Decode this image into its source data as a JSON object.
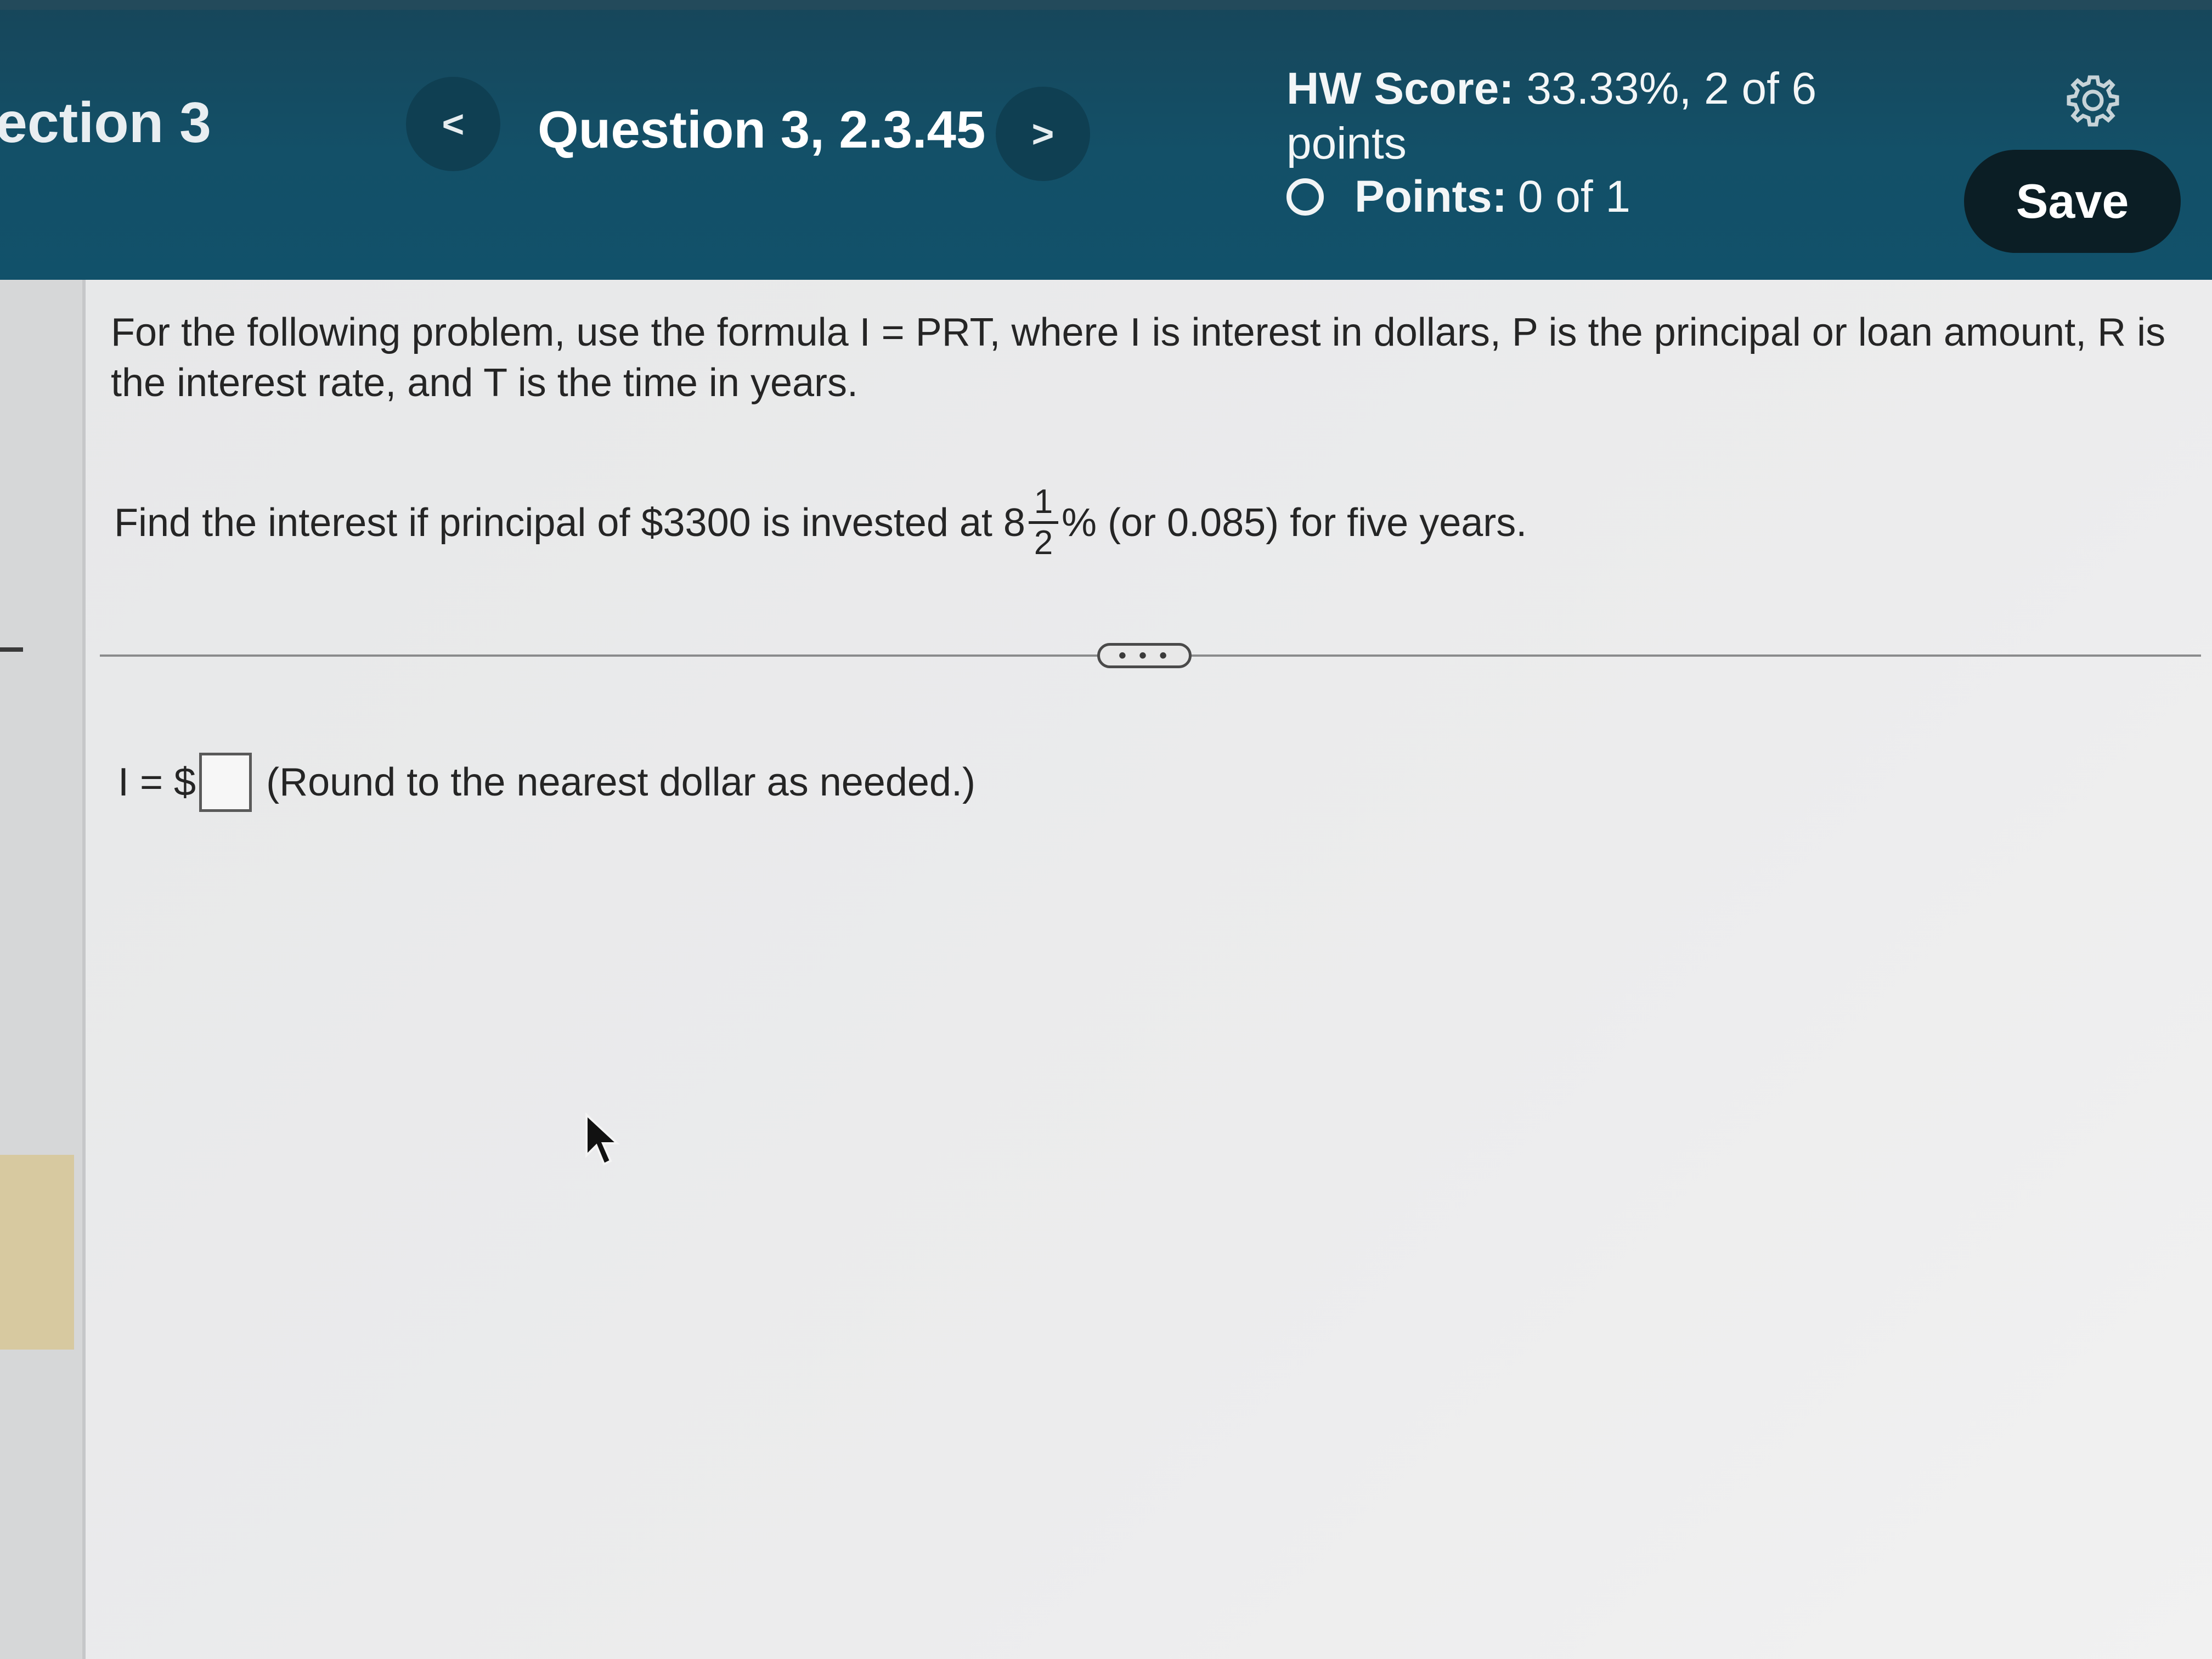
{
  "header": {
    "section_label": "ection 3",
    "question_title": "Question 3, 2.3.45",
    "prev_label": "<",
    "next_label": ">",
    "hw_score_label": "HW Score:",
    "hw_score_value": "33.33%, 2 of 6 points",
    "points_label": "Points:",
    "points_value": "0 of 1",
    "save_label": "Save",
    "colors": {
      "header_bg": "#135068",
      "save_bg": "#0b1e25"
    }
  },
  "problem": {
    "intro": "For the following problem, use the formula I = PRT, where I is interest in dollars, P is the principal or loan amount, R is the interest rate, and T is the time in years.",
    "question_before": "Find the interest if principal of $3300 is invested at 8",
    "fraction_numerator": "1",
    "fraction_denominator": "2",
    "question_after": "% (or 0.085) for five years."
  },
  "more_label": "• • •",
  "answer": {
    "prefix": "I = $",
    "value": "",
    "hint": "(Round to the nearest dollar as needed.)"
  },
  "icons": {
    "settings": "gear-icon",
    "points_status": "circle-outline-icon",
    "cursor": "mouse-pointer-icon"
  }
}
